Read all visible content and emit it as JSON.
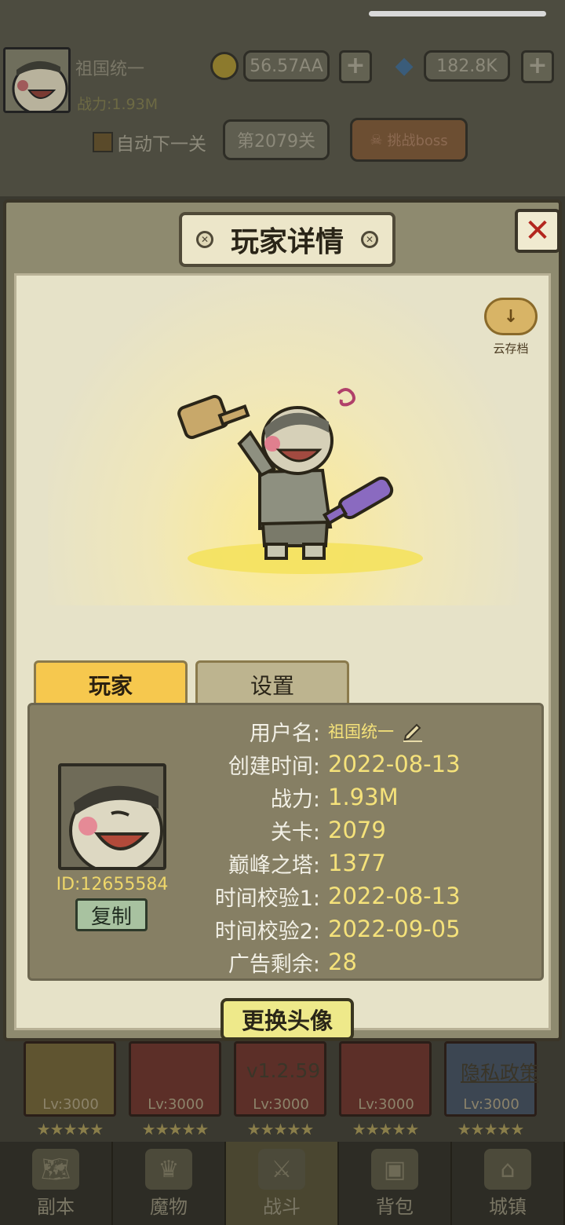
{
  "top_bar": {
    "player_name": "祖国统一",
    "gold": "56.57AA",
    "gems": "182.8K",
    "power": "战力:1.93M",
    "auto_next": "自动下一关",
    "stage": "第2079关",
    "boss_button": "挑战boss"
  },
  "modal": {
    "title": "玩家详情",
    "close_symbol": "✕",
    "cloud_save_label": "云存档",
    "tabs": [
      {
        "label": "玩家",
        "active": true
      },
      {
        "label": "设置",
        "active": false
      }
    ],
    "player_id": "ID:12655584",
    "copy_label": "复制",
    "fields": [
      {
        "label": "用户名:",
        "value": "祖国统一"
      },
      {
        "label": "创建时间:",
        "value": "2022-08-13"
      },
      {
        "label": "战力:",
        "value": "1.93M"
      },
      {
        "label": "关卡:",
        "value": "2079"
      },
      {
        "label": "巅峰之塔:",
        "value": "1377"
      },
      {
        "label": "时间校验1:",
        "value": "2022-08-13"
      },
      {
        "label": "时间校验2:",
        "value": "2022-09-05"
      },
      {
        "label": "广告剩余:",
        "value": "28"
      }
    ],
    "change_avatar_label": "更换头像",
    "version": "v1.2.59",
    "privacy_label": "隐私政策"
  },
  "hero_strip": [
    {
      "level": "Lv:3000"
    },
    {
      "level": "Lv:3000"
    },
    {
      "level": "Lv:3000"
    },
    {
      "level": "Lv:3000"
    },
    {
      "level": "Lv:3000"
    }
  ],
  "stars": "★★★★★",
  "bottom_nav": [
    {
      "label": "副本",
      "icon": "map-icon",
      "active": false
    },
    {
      "label": "魔物",
      "icon": "monster-icon",
      "active": false
    },
    {
      "label": "战斗",
      "icon": "swords-icon",
      "active": true
    },
    {
      "label": "背包",
      "icon": "backpack-icon",
      "active": false
    },
    {
      "label": "城镇",
      "icon": "town-icon",
      "active": false
    }
  ],
  "colors": {
    "accent_yellow": "#f5e27a",
    "tab_active": "#f6c84e",
    "close_red": "#b3261e"
  }
}
